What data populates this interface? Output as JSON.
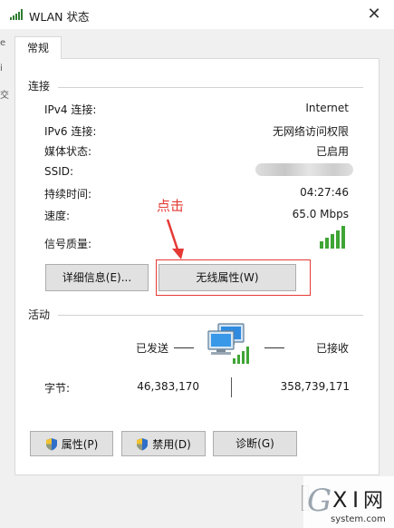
{
  "window": {
    "title": "WLAN 状态",
    "close_glyph": "✕"
  },
  "behind": {
    "glyphs": [
      "e",
      "i",
      "交"
    ]
  },
  "tab": {
    "label": "常规"
  },
  "connection": {
    "title": "连接",
    "rows": [
      {
        "label": "IPv4 连接:",
        "value": "Internet"
      },
      {
        "label": "IPv6 连接:",
        "value": "无网络访问权限"
      },
      {
        "label": "媒体状态:",
        "value": "已启用"
      },
      {
        "label": "SSID:",
        "value": ""
      },
      {
        "label": "持续时间:",
        "value": "04:27:46"
      },
      {
        "label": "速度:",
        "value": "65.0 Mbps"
      }
    ],
    "signal_label": "信号质量:",
    "signal_bars": 5,
    "signal_icon": "signal-bars-icon",
    "details_button": "详细信息(E)...",
    "wireless_button": "无线属性(W)"
  },
  "annotation": {
    "text": "点击",
    "color": "#e53935"
  },
  "activity": {
    "title": "活动",
    "sent_label": "已发送",
    "received_label": "已接收",
    "icon": "network-computers-icon",
    "bytes_label": "字节:",
    "bytes_sent": "46,383,170",
    "bytes_received": "358,739,171"
  },
  "buttons": {
    "properties": "属性(P)",
    "disable": "禁用(D)",
    "diagnose": "诊断(G)",
    "shield_icon": "uac-shield-icon"
  },
  "watermark": {
    "brand": "G X I 网",
    "domain": "system.com"
  }
}
